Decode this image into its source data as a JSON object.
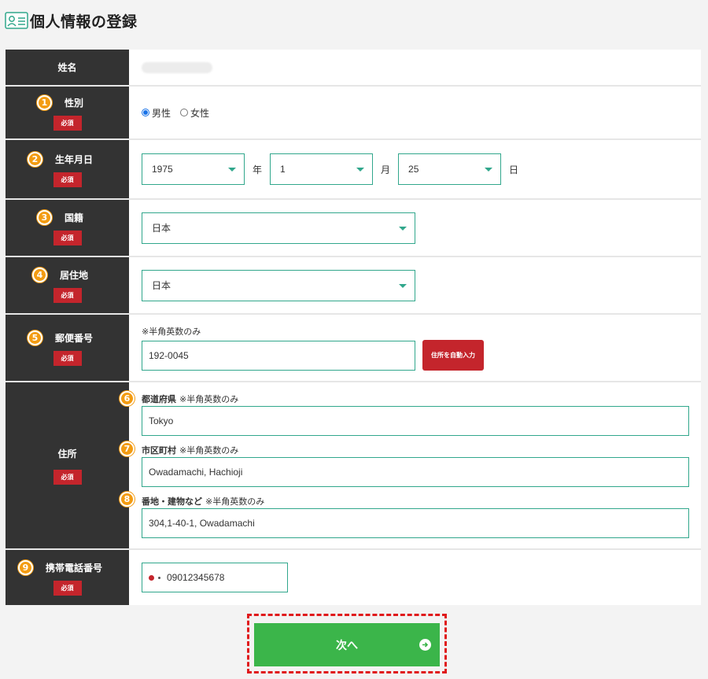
{
  "page": {
    "title": "個人情報の登録",
    "header_icon": "person-card-icon"
  },
  "colors": {
    "label_bg": "#333333",
    "accent_border": "#31a78c",
    "required_badge": "#c4252c",
    "step_badge": "#f39c12",
    "next_button": "#3bb54a",
    "highlight_border": "#e0191b"
  },
  "name_row": {
    "label": "姓名",
    "value": ""
  },
  "gender": {
    "num": "1",
    "label": "性別",
    "required": "必須",
    "options": [
      "男性",
      "女性"
    ],
    "selected": "男性"
  },
  "birthday": {
    "num": "2",
    "label": "生年月日",
    "required": "必須",
    "year": "1975",
    "year_unit": "年",
    "month": "1",
    "month_unit": "月",
    "day": "25",
    "day_unit": "日"
  },
  "nationality": {
    "num": "3",
    "label": "国籍",
    "required": "必須",
    "value": "日本"
  },
  "residence": {
    "num": "4",
    "label": "居住地",
    "required": "必須",
    "value": "日本"
  },
  "postal": {
    "num": "5",
    "label": "郵便番号",
    "required": "必須",
    "hint": "※半角英数のみ",
    "value": "192-0045",
    "auto_button": "住所を自動入力"
  },
  "address": {
    "label": "住所",
    "required": "必須",
    "prefecture": {
      "num": "6",
      "label": "都道府県",
      "hint": "※半角英数のみ",
      "value": "Tokyo"
    },
    "city": {
      "num": "7",
      "label": "市区町村",
      "hint": "※半角英数のみ",
      "value": "Owadamachi, Hachioji"
    },
    "street": {
      "num": "8",
      "label": "番地・建物など",
      "hint": "※半角英数のみ",
      "value": "304,1-40-1, Owadamachi"
    }
  },
  "phone": {
    "num": "9",
    "label": "携帯電話番号",
    "required": "必須",
    "value": "09012345678",
    "flag_icon": "japan-flag-icon"
  },
  "next": {
    "label": "次へ",
    "icon": "arrow-circle-right-icon"
  }
}
